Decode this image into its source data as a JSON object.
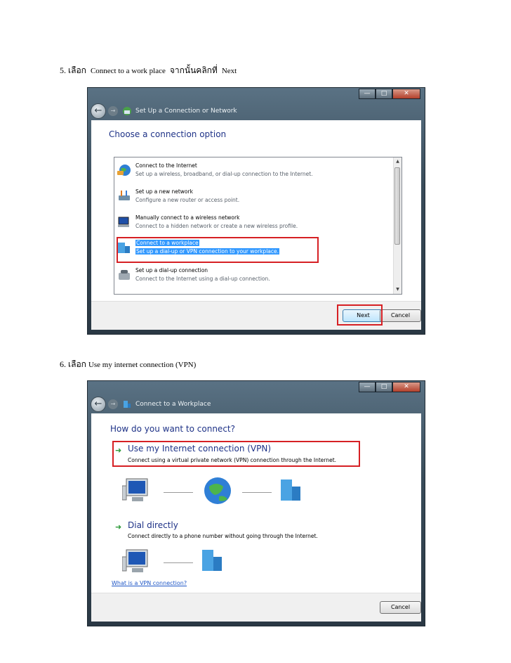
{
  "step5": {
    "number": "5.",
    "verb": "เลือก",
    "target": "Connect to a work place",
    "then": "จากนั้นคลิกที่",
    "button": "Next"
  },
  "step6": {
    "number": "6.",
    "verb": "เลือก",
    "target": "Use my internet connection (VPN)"
  },
  "dialog1": {
    "title": "Set Up a Connection or Network",
    "heading": "Choose a connection option",
    "options": [
      {
        "title": "Connect to the Internet",
        "desc": "Set up a wireless, broadband, or dial-up connection to the Internet.",
        "icon": "globe-icon"
      },
      {
        "title": "Set up a new network",
        "desc": "Configure a new router or access point.",
        "icon": "router-icon"
      },
      {
        "title": "Manually connect to a wireless network",
        "desc": "Connect to a hidden network or create a new wireless profile.",
        "icon": "wireless-computer-icon"
      },
      {
        "title": "Connect to a workplace",
        "desc": "Set up a dial-up or VPN connection to your workplace.",
        "icon": "workplace-icon",
        "selected": true
      },
      {
        "title": "Set up a dial-up connection",
        "desc": "Connect to the Internet using a dial-up connection.",
        "icon": "phone-icon"
      }
    ],
    "next_label": "Next",
    "cancel_label": "Cancel"
  },
  "dialog2": {
    "title": "Connect to a Workplace",
    "heading": "How do you want to connect?",
    "vpn_title": "Use my Internet connection (VPN)",
    "vpn_desc": "Connect using a virtual private network (VPN) connection through the Internet.",
    "dial_title": "Dial directly",
    "dial_desc": "Connect directly to a phone number without going through the Internet.",
    "help_link": "What is a VPN connection?",
    "cancel_label": "Cancel"
  },
  "colors": {
    "highlight_box": "#d62024",
    "selection": "#3399ff",
    "heading_blue": "#1e3287"
  }
}
